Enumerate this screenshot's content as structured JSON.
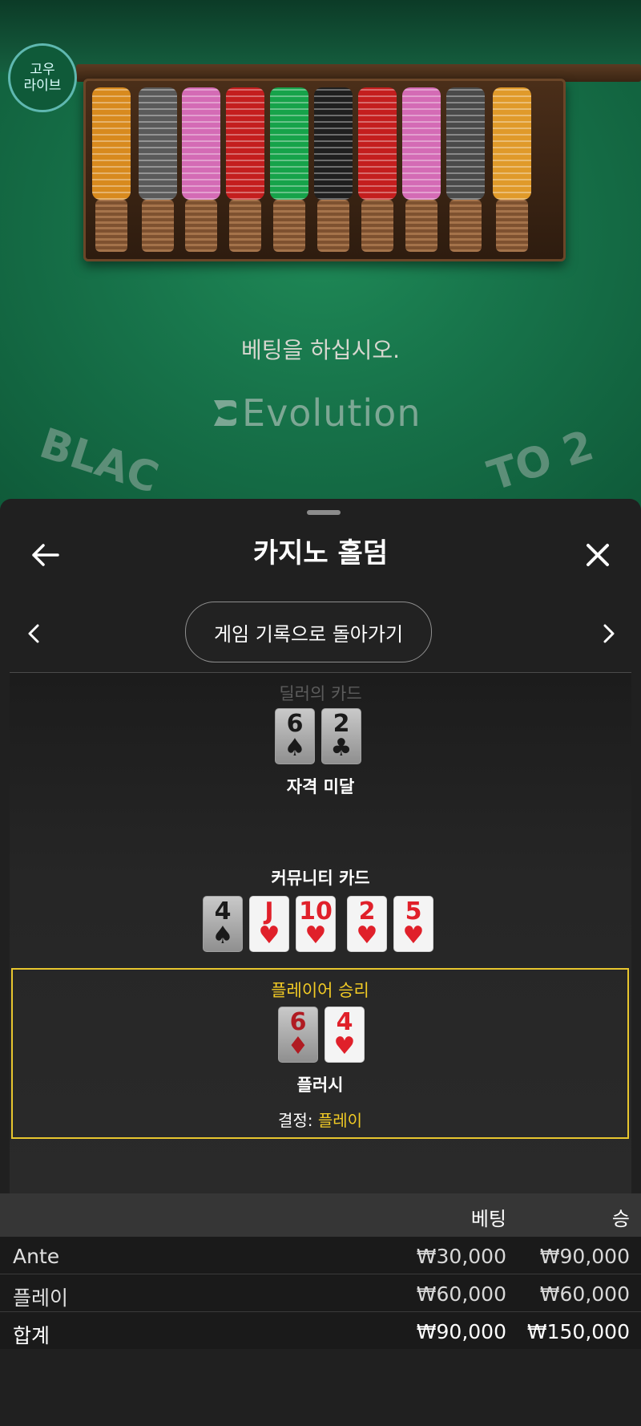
{
  "felt": {
    "badge_line1": "고우",
    "badge_line2": "라이브",
    "prompt": "베팅을 하십시오.",
    "brand": "Evolution",
    "arc_left": "BLAC",
    "arc_right": "TO 2",
    "chip_colors": [
      "#d88a1e",
      "#5a5a5a",
      "#d46bb5",
      "#c41e1e",
      "#16a34a",
      "#1f1f1f",
      "#c41e1e",
      "#d46bb5",
      "#4a4a4a",
      "#e09a2a"
    ]
  },
  "sheet": {
    "title": "카지노 홀덤",
    "back_history_label": "게임 기록으로 돌아가기",
    "dealer": {
      "label": "딜러의 카드",
      "cards": [
        {
          "rank": "6",
          "suit": "♠"
        },
        {
          "rank": "2",
          "suit": "♣"
        }
      ],
      "status": "자격 미달"
    },
    "community": {
      "label": "커뮤니티 카드",
      "cards": [
        {
          "rank": "4",
          "suit": "♠"
        },
        {
          "rank": "J",
          "suit": "♥"
        },
        {
          "rank": "10",
          "suit": "♥"
        },
        {
          "rank": "2",
          "suit": "♥"
        },
        {
          "rank": "5",
          "suit": "♥"
        }
      ]
    },
    "player": {
      "label": "플레이어 승리",
      "cards": [
        {
          "rank": "6",
          "suit": "♦"
        },
        {
          "rank": "4",
          "suit": "♥"
        }
      ],
      "hand": "플러시",
      "decision_label": "결정:",
      "decision_value": "플레이"
    }
  },
  "table": {
    "headers": [
      "",
      "베팅",
      "승"
    ],
    "rows": [
      {
        "name": "Ante",
        "bet": "₩30,000",
        "win": "₩90,000"
      },
      {
        "name": "플레이",
        "bet": "₩60,000",
        "win": "₩60,000"
      }
    ],
    "total": {
      "name": "합계",
      "bet": "₩90,000",
      "win": "₩150,000"
    }
  },
  "colors": {
    "accent_gold": "#f2cb25",
    "card_red": "#e0202a",
    "felt_green": "#17734a"
  }
}
